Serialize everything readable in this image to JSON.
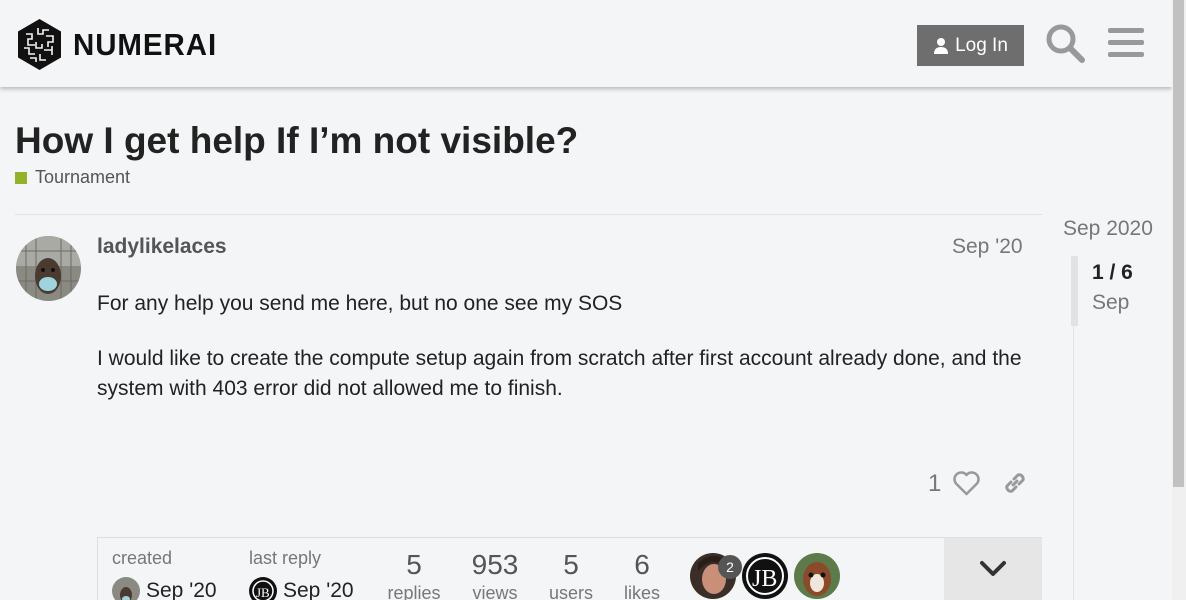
{
  "header": {
    "brand": "NUMERAI",
    "login_label": "Log In"
  },
  "topic": {
    "title": "How I get help If I’m not visible?",
    "category": "Tournament",
    "category_color": "#92b22c"
  },
  "post": {
    "username": "ladylikelaces",
    "date": "Sep '20",
    "paragraph_1": "For any help you send me here, but no one see my SOS",
    "paragraph_2": "I would like to create the compute setup again from scratch after first account already done, and the system with 403 error did not allowed me to finish.",
    "like_count": "1"
  },
  "topic_map": {
    "created_label": "created",
    "created_date": "Sep '20",
    "last_reply_label": "last reply",
    "last_reply_date": "Sep '20",
    "stats": [
      {
        "value": "5",
        "label": "replies"
      },
      {
        "value": "953",
        "label": "views"
      },
      {
        "value": "5",
        "label": "users"
      },
      {
        "value": "6",
        "label": "likes"
      }
    ],
    "participant_badge": "2"
  },
  "timeline": {
    "top_date": "Sep 2020",
    "position": "1 / 6",
    "position_date": "Sep"
  },
  "icons": {
    "search": "search-icon",
    "menu": "hamburger-menu-icon",
    "like": "heart-icon",
    "link": "link-icon",
    "expand": "chevron-down-icon",
    "user": "user-icon"
  }
}
